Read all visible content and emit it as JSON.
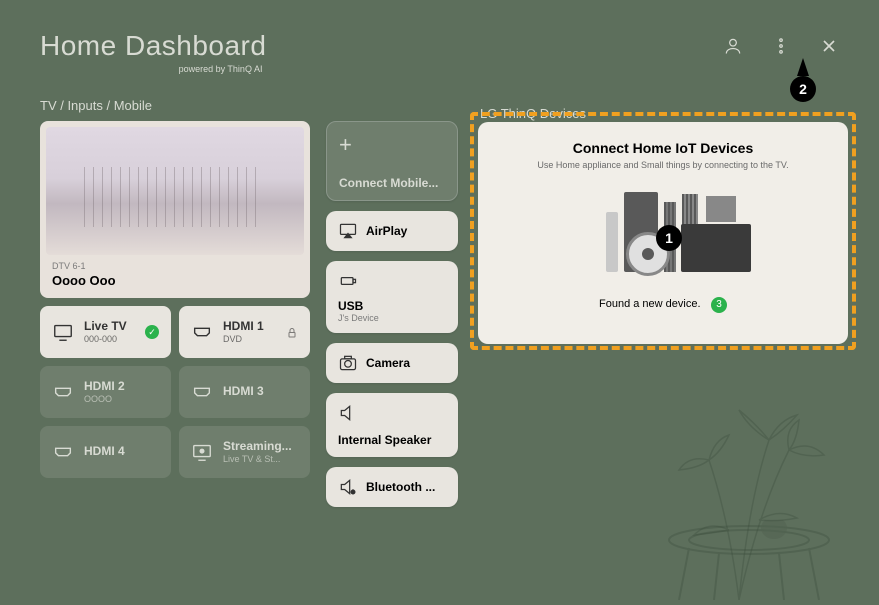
{
  "header": {
    "title": "Home Dashboard",
    "subtitle": "powered by ThinQ AI"
  },
  "section_label": "TV / Inputs / Mobile",
  "thinq_label": "LG ThinQ Devices",
  "preview": {
    "channel": "DTV 6-1",
    "name": "Oooo Ooo"
  },
  "inputs": [
    {
      "label": "Live TV",
      "sub": "000-000",
      "bright": true,
      "icon": "tv",
      "check": true
    },
    {
      "label": "HDMI 1",
      "sub": "DVD",
      "bright": true,
      "icon": "hdmi",
      "lock": true
    },
    {
      "label": "HDMI 2",
      "sub": "OOOO",
      "bright": false,
      "icon": "hdmi"
    },
    {
      "label": "HDMI 3",
      "sub": "",
      "bright": false,
      "icon": "hdmi"
    },
    {
      "label": "HDMI 4",
      "sub": "",
      "bright": false,
      "icon": "hdmi"
    },
    {
      "label": "Streaming...",
      "sub": "Live TV & St...",
      "bright": false,
      "icon": "stream"
    }
  ],
  "cards": {
    "connect_mobile": "Connect Mobile...",
    "airplay": "AirPlay",
    "usb": "USB",
    "usb_sub": "J's Device",
    "camera": "Camera",
    "internal_speaker": "Internal Speaker",
    "bluetooth": "Bluetooth ..."
  },
  "iot": {
    "title": "Connect Home IoT Devices",
    "subtitle": "Use Home appliance and Small things by connecting to the TV.",
    "found": "Found a new device.",
    "badge": "3"
  },
  "callouts": {
    "one": "1",
    "two": "2"
  }
}
